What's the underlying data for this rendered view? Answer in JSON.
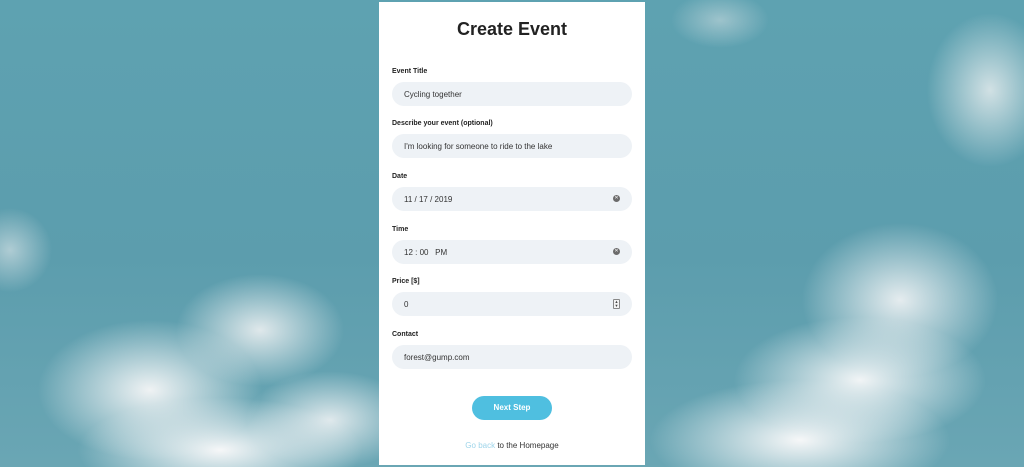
{
  "form": {
    "title": "Create Event",
    "fields": {
      "event_title": {
        "label": "Event Title",
        "value": "Cycling together"
      },
      "description": {
        "label": "Describe your event (optional)",
        "value": "I'm looking for someone to ride to the lake"
      },
      "date": {
        "label": "Date",
        "value": "11 / 17 / 2019"
      },
      "time": {
        "label": "Time",
        "value": "12 : 00   PM"
      },
      "price": {
        "label": "Price [$]",
        "value": "0"
      },
      "contact": {
        "label": "Contact",
        "value": "forest@gump.com"
      }
    },
    "next_button": "Next Step",
    "footer": {
      "link": "Go back",
      "rest": " to the Homepage"
    }
  },
  "colors": {
    "accent": "#4fbfe0",
    "link": "#9fd5ea",
    "input_bg": "#eef2f6"
  }
}
